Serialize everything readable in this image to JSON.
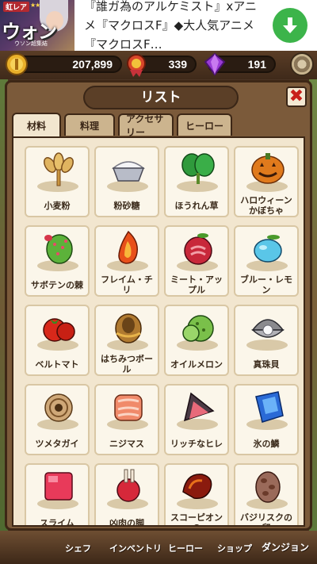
{
  "ad": {
    "rarity": "虹レア",
    "stars": "★★★★★",
    "name": "ウォン",
    "sub": "ウソン超集結",
    "text": "『誰ガ為のアルケミスト』xアニメ『マクロスF』◆大人気アニメ『マクロスF…"
  },
  "resources": {
    "gold": "207,899",
    "medal": "339",
    "gem": "191"
  },
  "panel": {
    "title": "リスト",
    "close": "✖"
  },
  "tabs": [
    "材料",
    "料理",
    "アクセサリー",
    "ヒーロー"
  ],
  "items": [
    {
      "label": "小麦粉",
      "icon": "wheat-icon"
    },
    {
      "label": "粉砂糖",
      "icon": "sugar-bowl-icon"
    },
    {
      "label": "ほうれん草",
      "icon": "spinach-icon"
    },
    {
      "label": "ハロウィーンかぼちゃ",
      "icon": "pumpkin-icon"
    },
    {
      "label": "サボテンの棘",
      "icon": "cactus-icon"
    },
    {
      "label": "フレイム・チリ",
      "icon": "flame-chili-icon"
    },
    {
      "label": "ミート・アップル",
      "icon": "meat-apple-icon"
    },
    {
      "label": "ブルー・レモン",
      "icon": "blue-lemon-icon"
    },
    {
      "label": "ベルトマト",
      "icon": "tomato-icon"
    },
    {
      "label": "はちみつボール",
      "icon": "honey-ball-icon"
    },
    {
      "label": "オイルメロン",
      "icon": "melon-icon"
    },
    {
      "label": "真珠貝",
      "icon": "pearl-shell-icon"
    },
    {
      "label": "ツメタガイ",
      "icon": "snail-shell-icon"
    },
    {
      "label": "ニジマス",
      "icon": "trout-icon"
    },
    {
      "label": "リッチなヒレ",
      "icon": "fin-icon"
    },
    {
      "label": "氷の鱗",
      "icon": "ice-scale-icon"
    },
    {
      "label": "スライム",
      "icon": "slime-icon"
    },
    {
      "label": "凶肉の脚",
      "icon": "meat-leg-icon"
    },
    {
      "label": "スコーピオンの",
      "icon": "scorpion-claw-icon"
    },
    {
      "label": "バジリスクの卵",
      "icon": "basilisk-egg-icon"
    }
  ],
  "nav": {
    "chef": "シェフ",
    "inventory": "インベントリ",
    "hero": "ヒーロー",
    "shop": "ショップ",
    "dungeon": "ダンジョン"
  }
}
